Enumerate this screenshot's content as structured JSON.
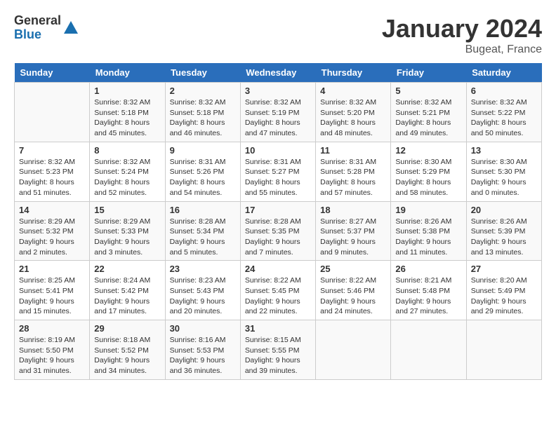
{
  "logo": {
    "general": "General",
    "blue": "Blue"
  },
  "title": "January 2024",
  "location": "Bugeat, France",
  "days_header": [
    "Sunday",
    "Monday",
    "Tuesday",
    "Wednesday",
    "Thursday",
    "Friday",
    "Saturday"
  ],
  "weeks": [
    [
      {
        "day": "",
        "sunrise": "",
        "sunset": "",
        "daylight": ""
      },
      {
        "day": "1",
        "sunrise": "Sunrise: 8:32 AM",
        "sunset": "Sunset: 5:18 PM",
        "daylight": "Daylight: 8 hours and 45 minutes."
      },
      {
        "day": "2",
        "sunrise": "Sunrise: 8:32 AM",
        "sunset": "Sunset: 5:18 PM",
        "daylight": "Daylight: 8 hours and 46 minutes."
      },
      {
        "day": "3",
        "sunrise": "Sunrise: 8:32 AM",
        "sunset": "Sunset: 5:19 PM",
        "daylight": "Daylight: 8 hours and 47 minutes."
      },
      {
        "day": "4",
        "sunrise": "Sunrise: 8:32 AM",
        "sunset": "Sunset: 5:20 PM",
        "daylight": "Daylight: 8 hours and 48 minutes."
      },
      {
        "day": "5",
        "sunrise": "Sunrise: 8:32 AM",
        "sunset": "Sunset: 5:21 PM",
        "daylight": "Daylight: 8 hours and 49 minutes."
      },
      {
        "day": "6",
        "sunrise": "Sunrise: 8:32 AM",
        "sunset": "Sunset: 5:22 PM",
        "daylight": "Daylight: 8 hours and 50 minutes."
      }
    ],
    [
      {
        "day": "7",
        "sunrise": "Sunrise: 8:32 AM",
        "sunset": "Sunset: 5:23 PM",
        "daylight": "Daylight: 8 hours and 51 minutes."
      },
      {
        "day": "8",
        "sunrise": "Sunrise: 8:32 AM",
        "sunset": "Sunset: 5:24 PM",
        "daylight": "Daylight: 8 hours and 52 minutes."
      },
      {
        "day": "9",
        "sunrise": "Sunrise: 8:31 AM",
        "sunset": "Sunset: 5:26 PM",
        "daylight": "Daylight: 8 hours and 54 minutes."
      },
      {
        "day": "10",
        "sunrise": "Sunrise: 8:31 AM",
        "sunset": "Sunset: 5:27 PM",
        "daylight": "Daylight: 8 hours and 55 minutes."
      },
      {
        "day": "11",
        "sunrise": "Sunrise: 8:31 AM",
        "sunset": "Sunset: 5:28 PM",
        "daylight": "Daylight: 8 hours and 57 minutes."
      },
      {
        "day": "12",
        "sunrise": "Sunrise: 8:30 AM",
        "sunset": "Sunset: 5:29 PM",
        "daylight": "Daylight: 8 hours and 58 minutes."
      },
      {
        "day": "13",
        "sunrise": "Sunrise: 8:30 AM",
        "sunset": "Sunset: 5:30 PM",
        "daylight": "Daylight: 9 hours and 0 minutes."
      }
    ],
    [
      {
        "day": "14",
        "sunrise": "Sunrise: 8:29 AM",
        "sunset": "Sunset: 5:32 PM",
        "daylight": "Daylight: 9 hours and 2 minutes."
      },
      {
        "day": "15",
        "sunrise": "Sunrise: 8:29 AM",
        "sunset": "Sunset: 5:33 PM",
        "daylight": "Daylight: 9 hours and 3 minutes."
      },
      {
        "day": "16",
        "sunrise": "Sunrise: 8:28 AM",
        "sunset": "Sunset: 5:34 PM",
        "daylight": "Daylight: 9 hours and 5 minutes."
      },
      {
        "day": "17",
        "sunrise": "Sunrise: 8:28 AM",
        "sunset": "Sunset: 5:35 PM",
        "daylight": "Daylight: 9 hours and 7 minutes."
      },
      {
        "day": "18",
        "sunrise": "Sunrise: 8:27 AM",
        "sunset": "Sunset: 5:37 PM",
        "daylight": "Daylight: 9 hours and 9 minutes."
      },
      {
        "day": "19",
        "sunrise": "Sunrise: 8:26 AM",
        "sunset": "Sunset: 5:38 PM",
        "daylight": "Daylight: 9 hours and 11 minutes."
      },
      {
        "day": "20",
        "sunrise": "Sunrise: 8:26 AM",
        "sunset": "Sunset: 5:39 PM",
        "daylight": "Daylight: 9 hours and 13 minutes."
      }
    ],
    [
      {
        "day": "21",
        "sunrise": "Sunrise: 8:25 AM",
        "sunset": "Sunset: 5:41 PM",
        "daylight": "Daylight: 9 hours and 15 minutes."
      },
      {
        "day": "22",
        "sunrise": "Sunrise: 8:24 AM",
        "sunset": "Sunset: 5:42 PM",
        "daylight": "Daylight: 9 hours and 17 minutes."
      },
      {
        "day": "23",
        "sunrise": "Sunrise: 8:23 AM",
        "sunset": "Sunset: 5:43 PM",
        "daylight": "Daylight: 9 hours and 20 minutes."
      },
      {
        "day": "24",
        "sunrise": "Sunrise: 8:22 AM",
        "sunset": "Sunset: 5:45 PM",
        "daylight": "Daylight: 9 hours and 22 minutes."
      },
      {
        "day": "25",
        "sunrise": "Sunrise: 8:22 AM",
        "sunset": "Sunset: 5:46 PM",
        "daylight": "Daylight: 9 hours and 24 minutes."
      },
      {
        "day": "26",
        "sunrise": "Sunrise: 8:21 AM",
        "sunset": "Sunset: 5:48 PM",
        "daylight": "Daylight: 9 hours and 27 minutes."
      },
      {
        "day": "27",
        "sunrise": "Sunrise: 8:20 AM",
        "sunset": "Sunset: 5:49 PM",
        "daylight": "Daylight: 9 hours and 29 minutes."
      }
    ],
    [
      {
        "day": "28",
        "sunrise": "Sunrise: 8:19 AM",
        "sunset": "Sunset: 5:50 PM",
        "daylight": "Daylight: 9 hours and 31 minutes."
      },
      {
        "day": "29",
        "sunrise": "Sunrise: 8:18 AM",
        "sunset": "Sunset: 5:52 PM",
        "daylight": "Daylight: 9 hours and 34 minutes."
      },
      {
        "day": "30",
        "sunrise": "Sunrise: 8:16 AM",
        "sunset": "Sunset: 5:53 PM",
        "daylight": "Daylight: 9 hours and 36 minutes."
      },
      {
        "day": "31",
        "sunrise": "Sunrise: 8:15 AM",
        "sunset": "Sunset: 5:55 PM",
        "daylight": "Daylight: 9 hours and 39 minutes."
      },
      {
        "day": "",
        "sunrise": "",
        "sunset": "",
        "daylight": ""
      },
      {
        "day": "",
        "sunrise": "",
        "sunset": "",
        "daylight": ""
      },
      {
        "day": "",
        "sunrise": "",
        "sunset": "",
        "daylight": ""
      }
    ]
  ]
}
